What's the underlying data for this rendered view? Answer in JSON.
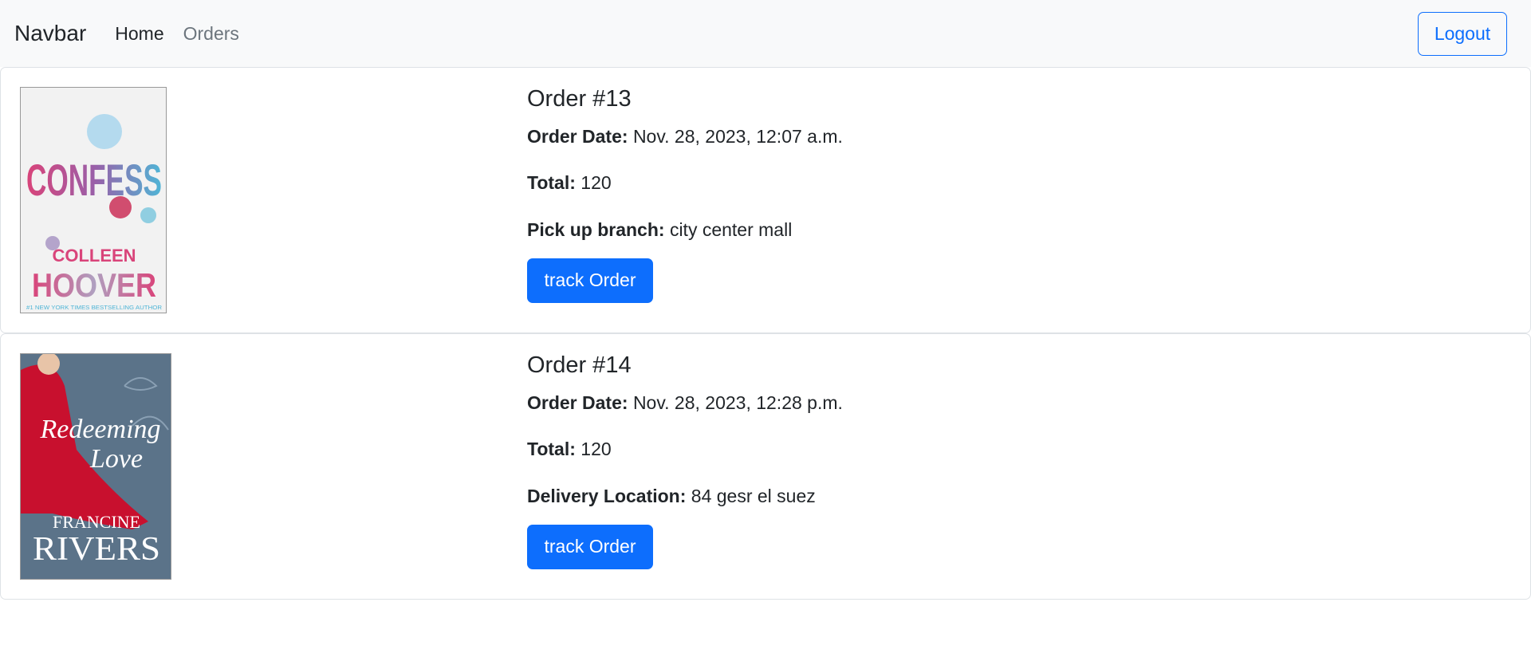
{
  "navbar": {
    "brand": "Navbar",
    "links": [
      {
        "label": "Home"
      },
      {
        "label": "Orders"
      }
    ],
    "logout_label": "Logout"
  },
  "orders": [
    {
      "title": "Order #13",
      "date_label": "Order Date:",
      "date_value": "Nov. 28, 2023, 12:07 a.m.",
      "total_label": "Total:",
      "total_value": "120",
      "location_label": "Pick up branch:",
      "location_value": "city center mall",
      "track_label": "track Order",
      "cover": {
        "line1": "CONFESS",
        "line2": "COLLEEN",
        "line3": "HOOVER",
        "line4": "#1 NEW YORK TIMES BESTSELLING AUTHOR"
      }
    },
    {
      "title": "Order #14",
      "date_label": "Order Date:",
      "date_value": "Nov. 28, 2023, 12:28 p.m.",
      "total_label": "Total:",
      "total_value": "120",
      "location_label": "Delivery Location:",
      "location_value": "84 gesr el suez",
      "track_label": "track Order",
      "cover": {
        "line1": "Redeeming",
        "line2": "Love",
        "line3": "FRANCINE",
        "line4": "RIVERS"
      }
    }
  ],
  "colors": {
    "primary": "#0d6efd",
    "navbar_bg": "#f8f9fa",
    "border": "#dee2e6"
  }
}
